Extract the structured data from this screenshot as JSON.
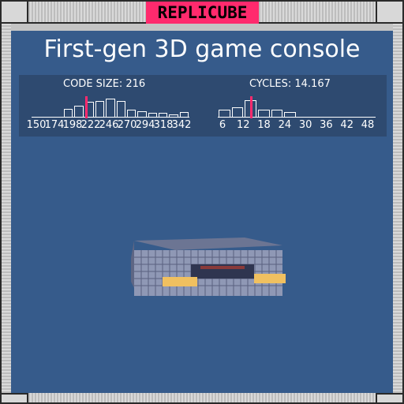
{
  "app": {
    "title": "REPLICUBE",
    "accent": "#ff2a6d",
    "background": "#365b8b"
  },
  "puzzle": {
    "name": "First-gen 3D game console"
  },
  "stats": {
    "code_size": {
      "label": "CODE SIZE: 216",
      "value": 216,
      "ticks": [
        "150",
        "174",
        "198",
        "222",
        "246",
        "270",
        "294",
        "318",
        "342"
      ],
      "histogram": [
        0.05,
        0.05,
        0.05,
        0.4,
        0.55,
        0.7,
        0.75,
        0.85,
        0.75,
        0.35,
        0.3,
        0.2,
        0.2,
        0.15,
        0.25
      ]
    },
    "cycles": {
      "label": "CYCLES: 14.167",
      "value": 14.167,
      "ticks": [
        "6",
        "12",
        "18",
        "24",
        "30",
        "36",
        "42",
        "48"
      ],
      "histogram": [
        0.35,
        0.45,
        0.8,
        0.35,
        0.35,
        0.25,
        0.05,
        0.05,
        0.05,
        0.05,
        0.05,
        0.05
      ]
    }
  },
  "object": {
    "name": "game-console-voxel-model",
    "colors": {
      "body": "#8f98b5",
      "accent_stripe": "#f0c060",
      "slot": "#8a3a3a"
    }
  }
}
